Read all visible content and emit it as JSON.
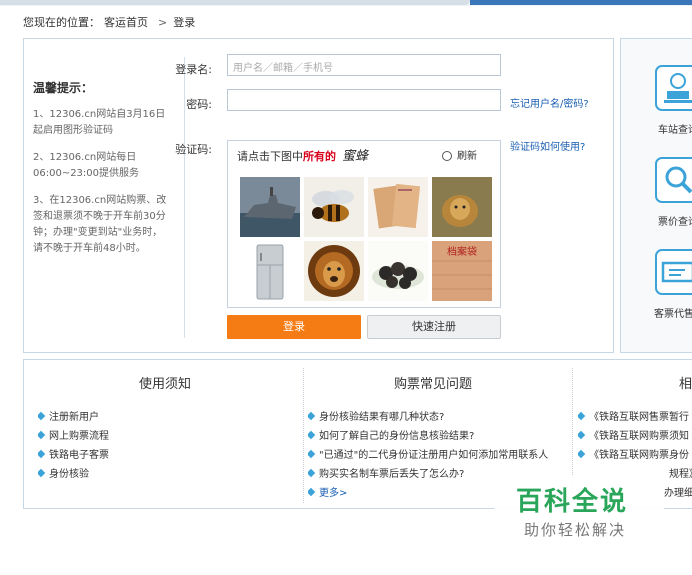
{
  "breadcrumb": {
    "prefix": "您现在的位置：",
    "home": "客运首页",
    "separator": ">",
    "current": "登录"
  },
  "tips": {
    "title": "温馨提示：",
    "items": [
      "1、12306.cn网站自3月16日起启用图形验证码",
      "2、12306.cn网站每日06:00~23:00提供服务",
      "3、在12306.cn网站购票、改签和退票须不晚于开车前30分钟；办理\"变更到站\"业务时，请不晚于开车前48小时。"
    ]
  },
  "form": {
    "username_label": "登录名:",
    "username_placeholder": "用户名／邮箱／手机号",
    "password_label": "密码:",
    "captcha_label": "验证码:",
    "forgot_link": "忘记用户名/密码?",
    "captcha_help_link": "验证码如何使用?"
  },
  "captcha": {
    "prompt_prefix": "请点击下图中",
    "prompt_highlight": "所有的",
    "target_word": "蜜蜂",
    "refresh_label": "刷新",
    "tiles": [
      "warship",
      "bee",
      "envelopes",
      "lion",
      "refrigerator",
      "lion",
      "dark-candies",
      "archive-bag"
    ],
    "tile_text_archive": "档案袋"
  },
  "buttons": {
    "login": "登录",
    "quick_register": "快速注册"
  },
  "services": [
    {
      "label": "车站查询",
      "icon": "station-icon"
    },
    {
      "label": "票价查询",
      "icon": "fare-search-icon"
    },
    {
      "label": "客票代售",
      "icon": "ticket-agent-icon"
    }
  ],
  "bottom": {
    "columns": [
      {
        "title": "使用须知",
        "items": [
          "注册新用户",
          "网上购票流程",
          "铁路电子客票",
          "身份核验"
        ]
      },
      {
        "title": "购票常见问题",
        "items": [
          "身份核验结果有哪几种状态?",
          "如何了解自己的身份信息核验结果?",
          "\"已通过\"的二代身份证注册用户如何添加常用联系人",
          "购买实名制车票后丢失了怎么办?"
        ],
        "more": "更多>"
      },
      {
        "title": "相",
        "items": [
          "《铁路互联网售票暂行",
          "《铁路互联网购票须知",
          "《铁路互联网购票身份"
        ],
        "extra": [
          "规程》",
          "办理细"
        ]
      }
    ]
  },
  "watermark": {
    "title": "百科全说",
    "subtitle": "助你轻松解决"
  },
  "colors": {
    "accent_orange": "#f57b14",
    "link_blue": "#1a5fb4",
    "border_blue": "#c6d7e6",
    "icon_blue": "#3ba3d8"
  }
}
